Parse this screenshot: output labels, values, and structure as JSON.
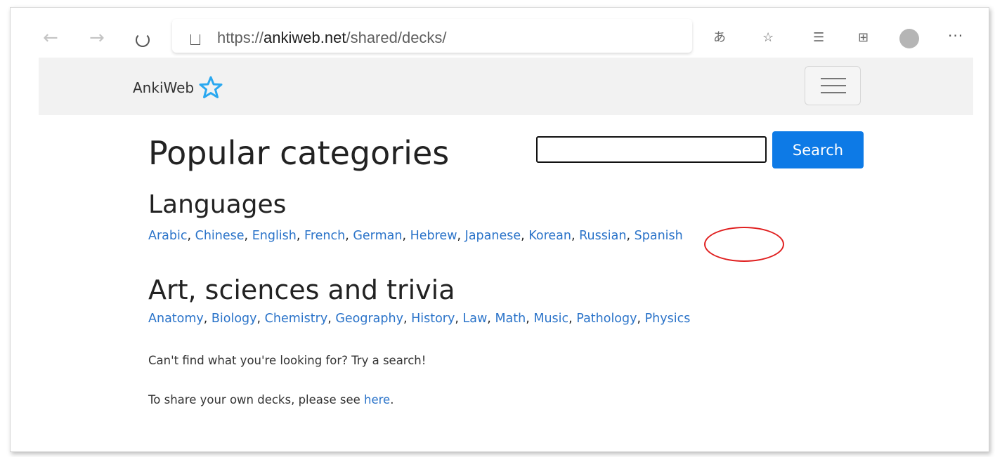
{
  "browser": {
    "url_prefix": "https://",
    "url_host": "ankiweb.net",
    "url_path": "/shared/decks/",
    "more_label": "···"
  },
  "navbar": {
    "brand": "AnkiWeb",
    "brand_color": "#2aa8f0"
  },
  "main": {
    "title": "Popular categories",
    "search": {
      "value": "",
      "button_label": "Search",
      "button_color": "#0d7ae6"
    },
    "sections": [
      {
        "heading": "Languages",
        "links": [
          "Arabic",
          "Chinese",
          "English",
          "French",
          "German",
          "Hebrew",
          "Japanese",
          "Korean",
          "Russian",
          "Spanish"
        ]
      },
      {
        "heading": "Art, sciences and trivia",
        "links": [
          "Anatomy",
          "Biology",
          "Chemistry",
          "Geography",
          "History",
          "Law",
          "Math",
          "Music",
          "Pathology",
          "Physics"
        ]
      }
    ],
    "help_text": "Can't find what you're looking for? Try a search!",
    "share_text_before": "To share your own decks, please see ",
    "share_link": "here",
    "share_text_after": "."
  },
  "annotation": {
    "highlighted": "Spanish",
    "color": "#e02020"
  }
}
